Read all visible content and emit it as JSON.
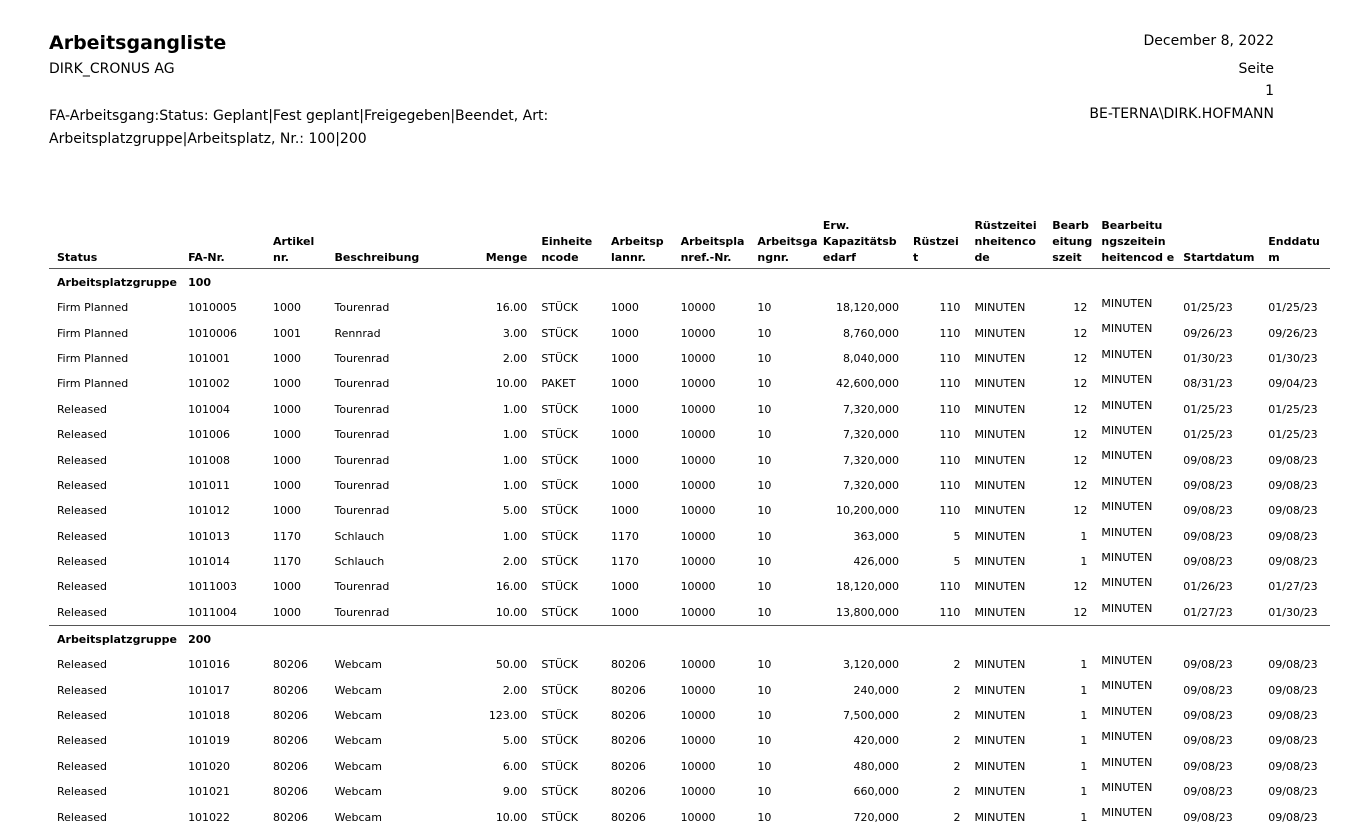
{
  "report": {
    "title": "Arbeitsgangliste",
    "company": "DIRK_CRONUS AG",
    "filter": "FA-Arbeitsgang:Status: Geplant|Fest geplant|Freigegeben|Beendet, Art: Arbeitsplatzgruppe|Arbeitsplatz, Nr.: 100|200",
    "date": "December 8, 2022",
    "page_label": "Seite",
    "page_number": "1",
    "user": "BE-TERNA\\DIRK.HOFMANN"
  },
  "columns": [
    "Status",
    "FA-Nr.",
    "Artikel nr.",
    "Beschreibung",
    "Menge",
    "Einheite ncode",
    "Arbeitsp lannr.",
    "Arbeitspla nref.-Nr.",
    "Arbeitsga ngnr.",
    "Erw. Kapazitätsb edarf",
    "Rüstzei t",
    "Rüstzeitei nheitenco de",
    "Bearb eitung szeit",
    "Bearbeitu ngszeitein heitencod e",
    "Startdatum",
    "Enddatu m"
  ],
  "groups": [
    {
      "type": "Arbeitsplatzgruppe",
      "no": "100",
      "rows": [
        [
          "Firm Planned",
          "1010005",
          "1000",
          "Tourenrad",
          "16.00",
          "STÜCK",
          "1000",
          "10000",
          "10",
          "18,120,000",
          "110",
          "MINUTEN",
          "12",
          "MINUTEN",
          "01/25/23",
          "01/25/23"
        ],
        [
          "Firm Planned",
          "1010006",
          "1001",
          "Rennrad",
          "3.00",
          "STÜCK",
          "1000",
          "10000",
          "10",
          "8,760,000",
          "110",
          "MINUTEN",
          "12",
          "MINUTEN",
          "09/26/23",
          "09/26/23"
        ],
        [
          "Firm Planned",
          "101001",
          "1000",
          "Tourenrad",
          "2.00",
          "STÜCK",
          "1000",
          "10000",
          "10",
          "8,040,000",
          "110",
          "MINUTEN",
          "12",
          "MINUTEN",
          "01/30/23",
          "01/30/23"
        ],
        [
          "Firm Planned",
          "101002",
          "1000",
          "Tourenrad",
          "10.00",
          "PAKET",
          "1000",
          "10000",
          "10",
          "42,600,000",
          "110",
          "MINUTEN",
          "12",
          "MINUTEN",
          "08/31/23",
          "09/04/23"
        ],
        [
          "Released",
          "101004",
          "1000",
          "Tourenrad",
          "1.00",
          "STÜCK",
          "1000",
          "10000",
          "10",
          "7,320,000",
          "110",
          "MINUTEN",
          "12",
          "MINUTEN",
          "01/25/23",
          "01/25/23"
        ],
        [
          "Released",
          "101006",
          "1000",
          "Tourenrad",
          "1.00",
          "STÜCK",
          "1000",
          "10000",
          "10",
          "7,320,000",
          "110",
          "MINUTEN",
          "12",
          "MINUTEN",
          "01/25/23",
          "01/25/23"
        ],
        [
          "Released",
          "101008",
          "1000",
          "Tourenrad",
          "1.00",
          "STÜCK",
          "1000",
          "10000",
          "10",
          "7,320,000",
          "110",
          "MINUTEN",
          "12",
          "MINUTEN",
          "09/08/23",
          "09/08/23"
        ],
        [
          "Released",
          "101011",
          "1000",
          "Tourenrad",
          "1.00",
          "STÜCK",
          "1000",
          "10000",
          "10",
          "7,320,000",
          "110",
          "MINUTEN",
          "12",
          "MINUTEN",
          "09/08/23",
          "09/08/23"
        ],
        [
          "Released",
          "101012",
          "1000",
          "Tourenrad",
          "5.00",
          "STÜCK",
          "1000",
          "10000",
          "10",
          "10,200,000",
          "110",
          "MINUTEN",
          "12",
          "MINUTEN",
          "09/08/23",
          "09/08/23"
        ],
        [
          "Released",
          "101013",
          "1170",
          "Schlauch",
          "1.00",
          "STÜCK",
          "1170",
          "10000",
          "10",
          "363,000",
          "5",
          "MINUTEN",
          "1",
          "MINUTEN",
          "09/08/23",
          "09/08/23"
        ],
        [
          "Released",
          "101014",
          "1170",
          "Schlauch",
          "2.00",
          "STÜCK",
          "1170",
          "10000",
          "10",
          "426,000",
          "5",
          "MINUTEN",
          "1",
          "MINUTEN",
          "09/08/23",
          "09/08/23"
        ],
        [
          "Released",
          "1011003",
          "1000",
          "Tourenrad",
          "16.00",
          "STÜCK",
          "1000",
          "10000",
          "10",
          "18,120,000",
          "110",
          "MINUTEN",
          "12",
          "MINUTEN",
          "01/26/23",
          "01/27/23"
        ],
        [
          "Released",
          "1011004",
          "1000",
          "Tourenrad",
          "10.00",
          "STÜCK",
          "1000",
          "10000",
          "10",
          "13,800,000",
          "110",
          "MINUTEN",
          "12",
          "MINUTEN",
          "01/27/23",
          "01/30/23"
        ]
      ]
    },
    {
      "type": "Arbeitsplatzgruppe",
      "no": "200",
      "rows": [
        [
          "Released",
          "101016",
          "80206",
          "Webcam",
          "50.00",
          "STÜCK",
          "80206",
          "10000",
          "10",
          "3,120,000",
          "2",
          "MINUTEN",
          "1",
          "MINUTEN",
          "09/08/23",
          "09/08/23"
        ],
        [
          "Released",
          "101017",
          "80206",
          "Webcam",
          "2.00",
          "STÜCK",
          "80206",
          "10000",
          "10",
          "240,000",
          "2",
          "MINUTEN",
          "1",
          "MINUTEN",
          "09/08/23",
          "09/08/23"
        ],
        [
          "Released",
          "101018",
          "80206",
          "Webcam",
          "123.00",
          "STÜCK",
          "80206",
          "10000",
          "10",
          "7,500,000",
          "2",
          "MINUTEN",
          "1",
          "MINUTEN",
          "09/08/23",
          "09/08/23"
        ],
        [
          "Released",
          "101019",
          "80206",
          "Webcam",
          "5.00",
          "STÜCK",
          "80206",
          "10000",
          "10",
          "420,000",
          "2",
          "MINUTEN",
          "1",
          "MINUTEN",
          "09/08/23",
          "09/08/23"
        ],
        [
          "Released",
          "101020",
          "80206",
          "Webcam",
          "6.00",
          "STÜCK",
          "80206",
          "10000",
          "10",
          "480,000",
          "2",
          "MINUTEN",
          "1",
          "MINUTEN",
          "09/08/23",
          "09/08/23"
        ],
        [
          "Released",
          "101021",
          "80206",
          "Webcam",
          "9.00",
          "STÜCK",
          "80206",
          "10000",
          "10",
          "660,000",
          "2",
          "MINUTEN",
          "1",
          "MINUTEN",
          "09/08/23",
          "09/08/23"
        ],
        [
          "Released",
          "101022",
          "80206",
          "Webcam",
          "10.00",
          "STÜCK",
          "80206",
          "10000",
          "10",
          "720,000",
          "2",
          "MINUTEN",
          "1",
          "MINUTEN",
          "09/08/23",
          "09/08/23"
        ]
      ]
    }
  ]
}
